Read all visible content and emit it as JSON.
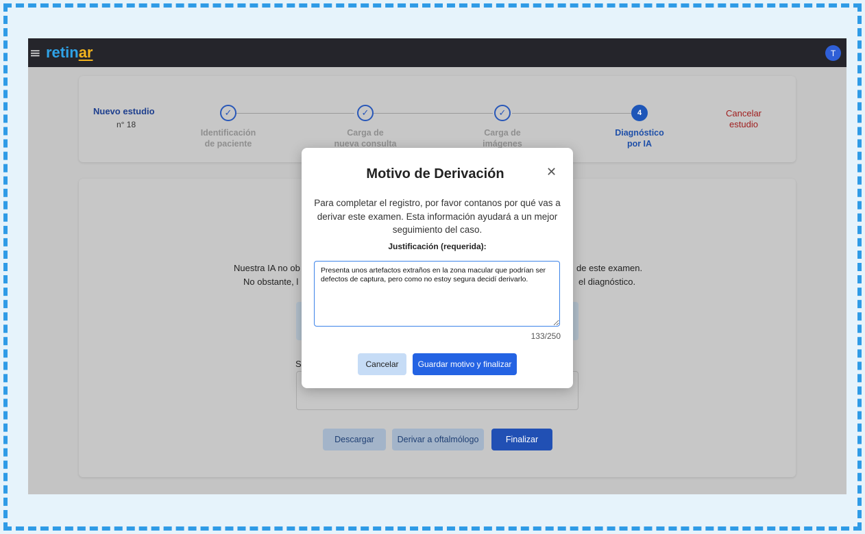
{
  "brand": {
    "logo_part1": "retin",
    "logo_part2": "ar"
  },
  "header": {
    "menu_icon": "≡",
    "avatar_initial": "T"
  },
  "stepper": {
    "study_title": "Nuevo estudio",
    "study_number": "n° 18",
    "steps": [
      {
        "marker": "✓",
        "line1": "Identificación",
        "line2": "de paciente"
      },
      {
        "marker": "✓",
        "line1": "Carga de",
        "line2": "nueva consulta"
      },
      {
        "marker": "✓",
        "line1": "Carga de",
        "line2": "imágenes"
      },
      {
        "marker": "4",
        "line1": "Diagnóstico",
        "line2": "por IA"
      }
    ],
    "cancel_line1": "Cancelar",
    "cancel_line2": "estudio"
  },
  "background": {
    "line1_left": "Nuestra IA no ob",
    "line1_right": "de este examen.",
    "line2_left": "No obstante, l",
    "line2_right": "el diagnóstico.",
    "partial_label": "S",
    "buttons": {
      "download": "Descargar",
      "refer": "Derivar a oftalmólogo",
      "finish": "Finalizar"
    }
  },
  "modal": {
    "title": "Motivo de Derivación",
    "close_icon": "✕",
    "description": "Para completar el registro, por favor contanos por qué vas a derivar este examen. Esta información ayudará a un mejor seguimiento del caso.",
    "justification_label": "Justificación (requerida):",
    "textarea_value": "Presenta unos artefactos extraños en la zona macular que podrían ser defectos de captura, pero como no estoy segura decidí derivarlo.",
    "char_count": "133/250",
    "cancel_label": "Cancelar",
    "save_label": "Guardar motivo y finalizar"
  },
  "colors": {
    "primary": "#2463e3",
    "brand_blue": "#2fa3e8",
    "brand_yellow": "#f2b41e",
    "danger": "#9f1c1c",
    "topbar": "#25252b"
  }
}
